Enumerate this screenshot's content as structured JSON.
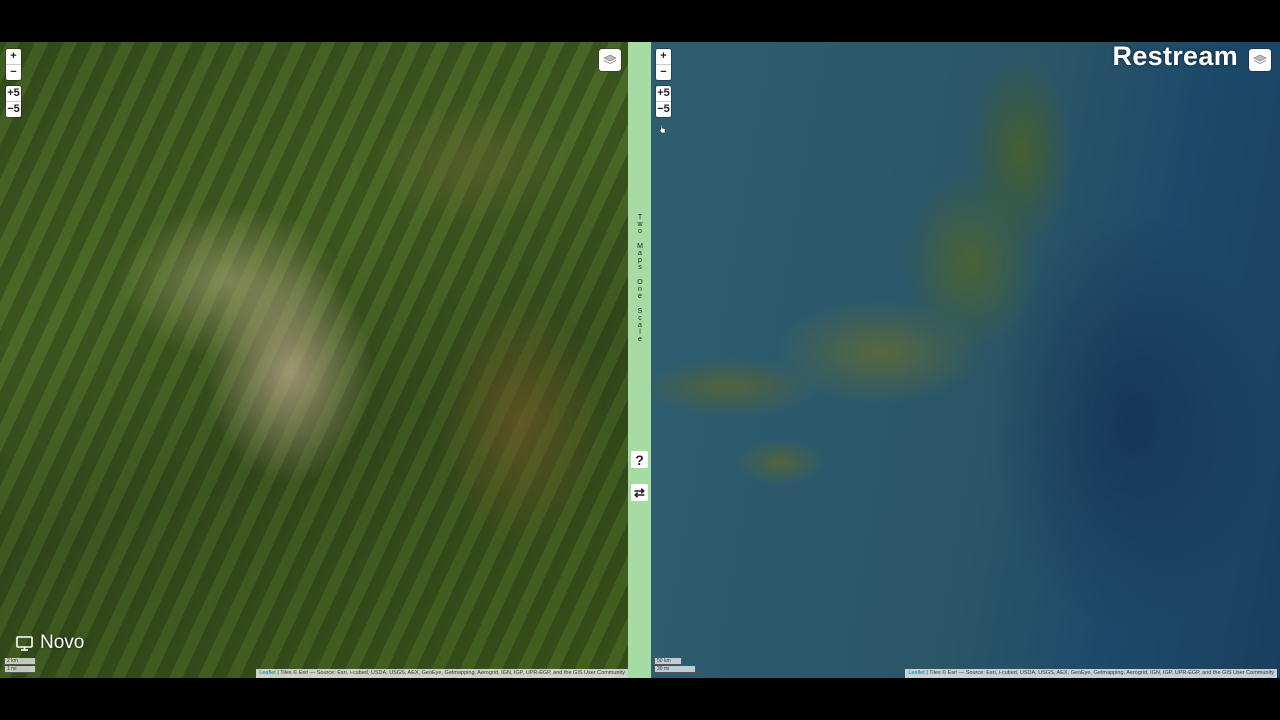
{
  "left_map": {
    "zoom_in": "+",
    "zoom_out": "−",
    "step_up": "+5",
    "step_down": "−5",
    "scale_metric": "2 km",
    "scale_imperial": "1 mi",
    "attribution_leaflet": "Leaflet",
    "attribution_text": "| Tiles © Esri — Source: Esri, i-cubed, USDA, USGS, AEX, GeoEye, Getmapping, Aerogrid, IGN, IGP, UPR-EGP, and the GIS User Community"
  },
  "right_map": {
    "zoom_in": "+",
    "zoom_out": "−",
    "step_up": "+5",
    "step_down": "−5",
    "scale_metric": "50 km",
    "scale_imperial": "30 mi",
    "attribution_leaflet": "Leaflet",
    "attribution_text": "| Tiles © Esri — Source: Esri, i-cubed, USDA, USGS, AEX, GeoEye, Getmapping, Aerogrid, IGN, IGP, UPR-EGP, and the GIS User Community"
  },
  "divider": {
    "title_words": [
      "Two",
      "Maps",
      "One",
      "Scale"
    ],
    "help_label": "?",
    "swap_label": "⇄"
  },
  "overlay": {
    "brand": "Restream",
    "novo_label": "Novo"
  },
  "colors": {
    "divider": "#a6dca3",
    "background": "#000000"
  }
}
